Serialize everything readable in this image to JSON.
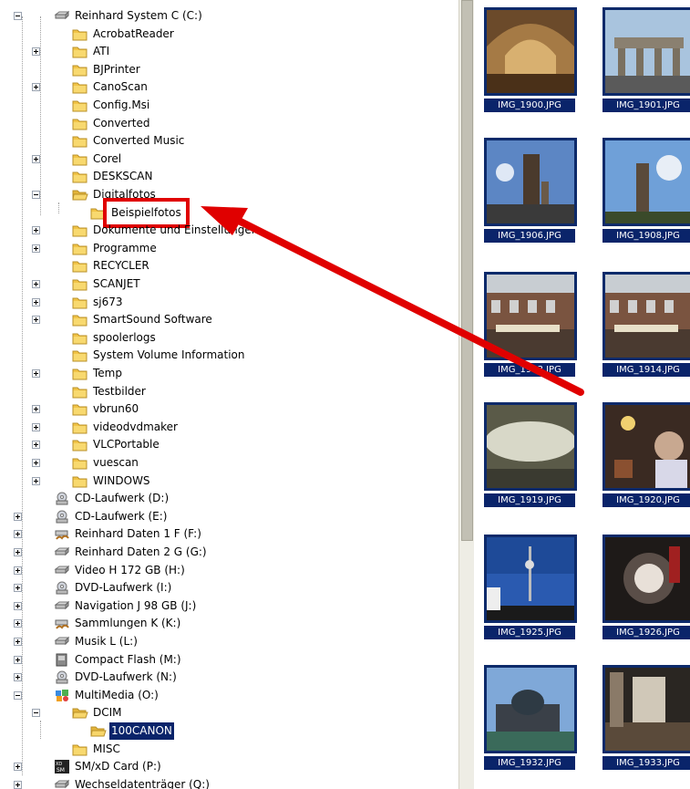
{
  "tree": {
    "items": [
      {
        "label": "Reinhard System C (C:)",
        "level": 0,
        "exp": "minus",
        "icon": "hdd-icon"
      },
      {
        "label": "AcrobatReader",
        "level": 1,
        "exp": "",
        "icon": "folder-icon"
      },
      {
        "label": "ATI",
        "level": 1,
        "exp": "plus",
        "icon": "folder-icon"
      },
      {
        "label": "BJPrinter",
        "level": 1,
        "exp": "",
        "icon": "folder-icon"
      },
      {
        "label": "CanoScan",
        "level": 1,
        "exp": "plus",
        "icon": "folder-icon"
      },
      {
        "label": "Config.Msi",
        "level": 1,
        "exp": "",
        "icon": "folder-icon"
      },
      {
        "label": "Converted",
        "level": 1,
        "exp": "",
        "icon": "folder-icon"
      },
      {
        "label": "Converted Music",
        "level": 1,
        "exp": "",
        "icon": "folder-icon"
      },
      {
        "label": "Corel",
        "level": 1,
        "exp": "plus",
        "icon": "folder-icon"
      },
      {
        "label": "DESKSCAN",
        "level": 1,
        "exp": "",
        "icon": "folder-icon"
      },
      {
        "label": "Digitalfotos",
        "level": 1,
        "exp": "minus",
        "icon": "folder-open-icon"
      },
      {
        "label": "Beispielfotos",
        "level": 2,
        "exp": "",
        "icon": "folder-icon",
        "highlight": true
      },
      {
        "label": "Dokumente und Einstellungen",
        "level": 1,
        "exp": "plus",
        "icon": "folder-icon"
      },
      {
        "label": "Programme",
        "level": 1,
        "exp": "plus",
        "icon": "folder-icon"
      },
      {
        "label": "RECYCLER",
        "level": 1,
        "exp": "",
        "icon": "folder-icon"
      },
      {
        "label": "SCANJET",
        "level": 1,
        "exp": "plus",
        "icon": "folder-icon"
      },
      {
        "label": "sj673",
        "level": 1,
        "exp": "plus",
        "icon": "folder-icon"
      },
      {
        "label": "SmartSound Software",
        "level": 1,
        "exp": "plus",
        "icon": "folder-icon"
      },
      {
        "label": "spoolerlogs",
        "level": 1,
        "exp": "",
        "icon": "folder-icon"
      },
      {
        "label": "System Volume Information",
        "level": 1,
        "exp": "",
        "icon": "folder-icon"
      },
      {
        "label": "Temp",
        "level": 1,
        "exp": "plus",
        "icon": "folder-icon"
      },
      {
        "label": "Testbilder",
        "level": 1,
        "exp": "",
        "icon": "folder-icon"
      },
      {
        "label": "vbrun60",
        "level": 1,
        "exp": "plus",
        "icon": "folder-icon"
      },
      {
        "label": "videodvdmaker",
        "level": 1,
        "exp": "plus",
        "icon": "folder-icon"
      },
      {
        "label": "VLCPortable",
        "level": 1,
        "exp": "plus",
        "icon": "folder-icon"
      },
      {
        "label": "vuescan",
        "level": 1,
        "exp": "plus",
        "icon": "folder-icon"
      },
      {
        "label": "WINDOWS",
        "level": 1,
        "exp": "plus",
        "icon": "folder-icon"
      },
      {
        "label": "CD-Laufwerk (D:)",
        "level": 0,
        "exp": "",
        "icon": "cd-drive-icon"
      },
      {
        "label": "CD-Laufwerk (E:)",
        "level": 0,
        "exp": "plus",
        "icon": "cd-drive-icon"
      },
      {
        "label": "Reinhard Daten 1 F (F:)",
        "level": 0,
        "exp": "plus",
        "icon": "shared-drive-icon"
      },
      {
        "label": "Reinhard Daten 2 G (G:)",
        "level": 0,
        "exp": "plus",
        "icon": "hdd-icon"
      },
      {
        "label": "Video H 172 GB (H:)",
        "level": 0,
        "exp": "plus",
        "icon": "hdd-icon"
      },
      {
        "label": "DVD-Laufwerk (I:)",
        "level": 0,
        "exp": "plus",
        "icon": "cd-drive-icon"
      },
      {
        "label": "Navigation J 98 GB (J:)",
        "level": 0,
        "exp": "plus",
        "icon": "hdd-icon"
      },
      {
        "label": "Sammlungen  K (K:)",
        "level": 0,
        "exp": "plus",
        "icon": "shared-drive-icon"
      },
      {
        "label": "Musik L (L:)",
        "level": 0,
        "exp": "plus",
        "icon": "hdd-icon"
      },
      {
        "label": "Compact Flash (M:)",
        "level": 0,
        "exp": "plus",
        "icon": "removable-drive-icon"
      },
      {
        "label": "DVD-Laufwerk (N:)",
        "level": 0,
        "exp": "plus",
        "icon": "cd-drive-icon"
      },
      {
        "label": "MultiMedia (O:)",
        "level": 0,
        "exp": "minus",
        "icon": "multimedia-drive-icon"
      },
      {
        "label": "DCIM",
        "level": 1,
        "exp": "minus",
        "icon": "folder-open-icon"
      },
      {
        "label": "100CANON",
        "level": 2,
        "exp": "",
        "icon": "folder-open-icon",
        "selected": true
      },
      {
        "label": "MISC",
        "level": 1,
        "exp": "",
        "icon": "folder-icon"
      },
      {
        "label": "SM/xD Card (P:)",
        "level": 0,
        "exp": "plus",
        "icon": "smxd-card-icon"
      },
      {
        "label": "Wechseldatenträger (Q:)",
        "level": 0,
        "exp": "plus",
        "icon": "hdd-icon"
      }
    ]
  },
  "thumbnails": [
    {
      "name": "IMG_1900.JPG",
      "scene": "arch-hall"
    },
    {
      "name": "IMG_1901.JPG",
      "scene": "gate"
    },
    {
      "name": "IMG_1906.JPG",
      "scene": "church-tower"
    },
    {
      "name": "IMG_1908.JPG",
      "scene": "tower-sky"
    },
    {
      "name": "IMG_1913.JPG",
      "scene": "market"
    },
    {
      "name": "IMG_1914.JPG",
      "scene": "market"
    },
    {
      "name": "IMG_1919.JPG",
      "scene": "blurry"
    },
    {
      "name": "IMG_1920.JPG",
      "scene": "people"
    },
    {
      "name": "IMG_1925.JPG",
      "scene": "tv-tower"
    },
    {
      "name": "IMG_1926.JPG",
      "scene": "dark-dome"
    },
    {
      "name": "IMG_1932.JPG",
      "scene": "cathedral"
    },
    {
      "name": "IMG_1933.JPG",
      "scene": "interior"
    }
  ],
  "colors": {
    "selection": "#0a246a",
    "annotation": "#e00000",
    "thumb_border": "#0d2a6a",
    "folder": "#f2c447"
  }
}
